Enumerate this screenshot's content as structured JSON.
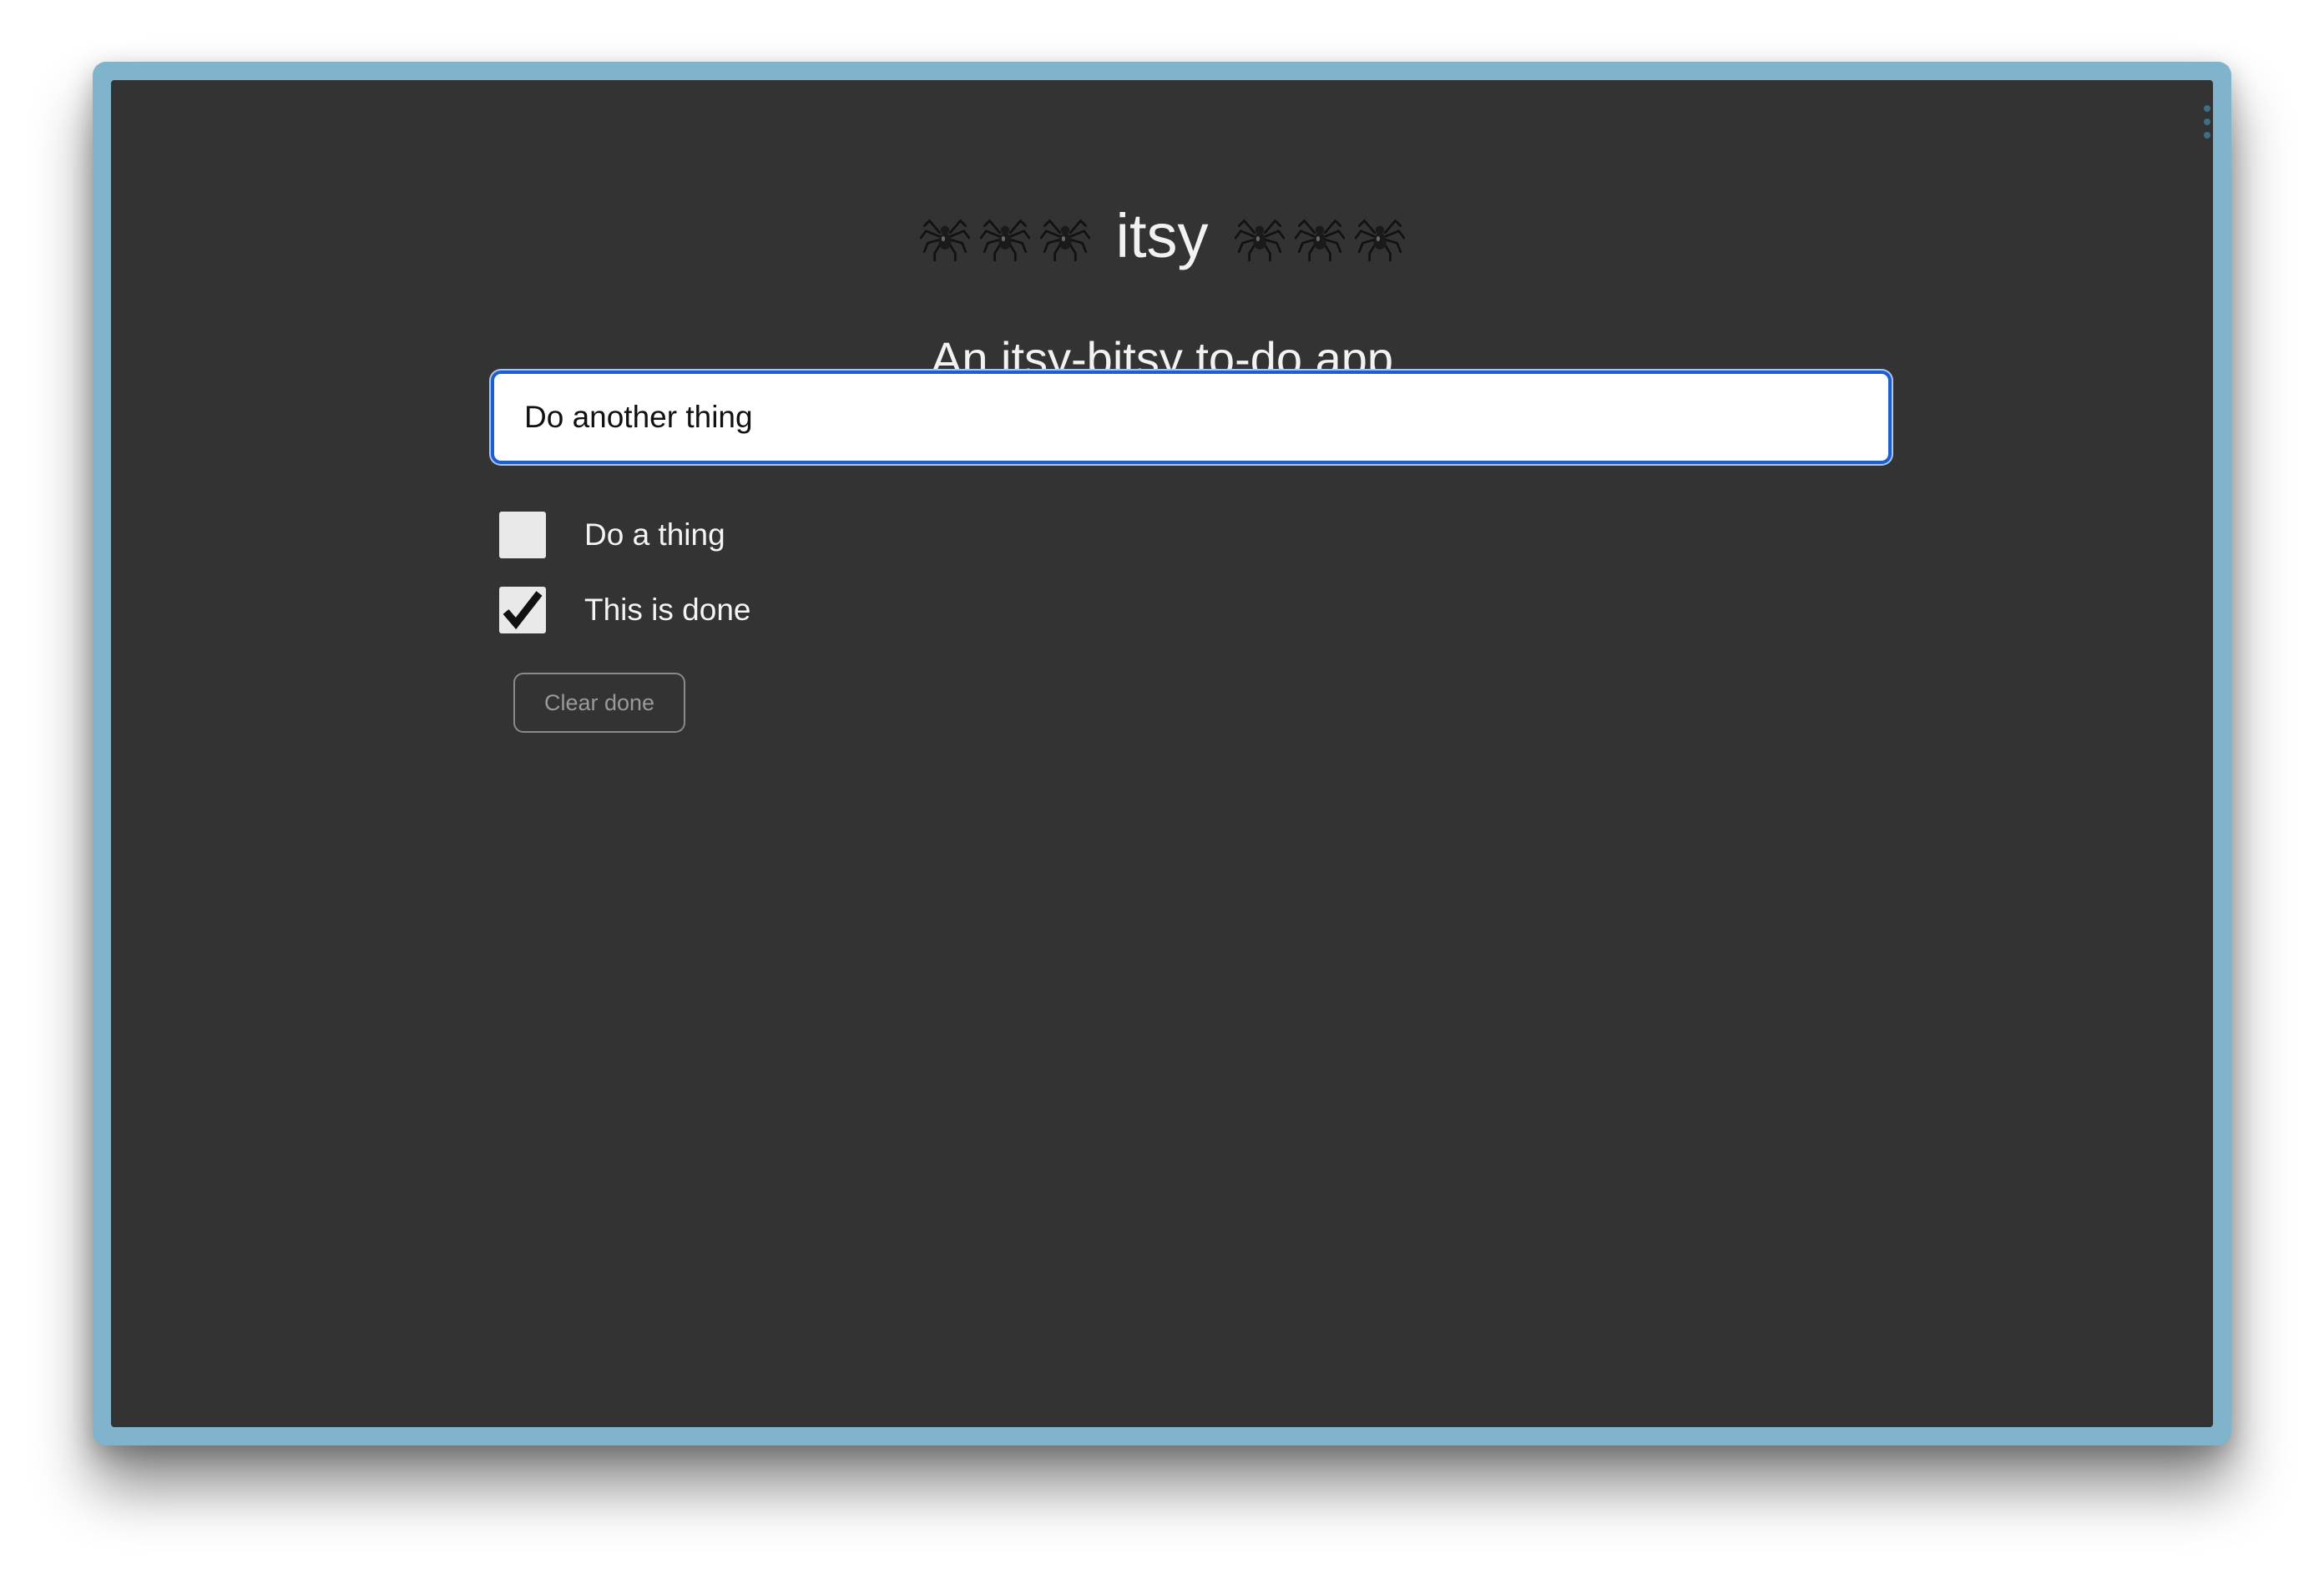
{
  "app": {
    "title": "itsy",
    "subtitle": "An itsy-bitsy to-do app",
    "decoration_icon": "spider-icon"
  },
  "input": {
    "value": "Do another thing",
    "placeholder": ""
  },
  "todos": [
    {
      "label": "Do a thing",
      "done": false
    },
    {
      "label": "This is done",
      "done": true
    }
  ],
  "actions": {
    "clear_done_label": "Clear done"
  },
  "colors": {
    "frame": "#7fb4cc",
    "background": "#333333",
    "text": "#f2f2f2",
    "focus_ring": "#1e5fd0"
  }
}
